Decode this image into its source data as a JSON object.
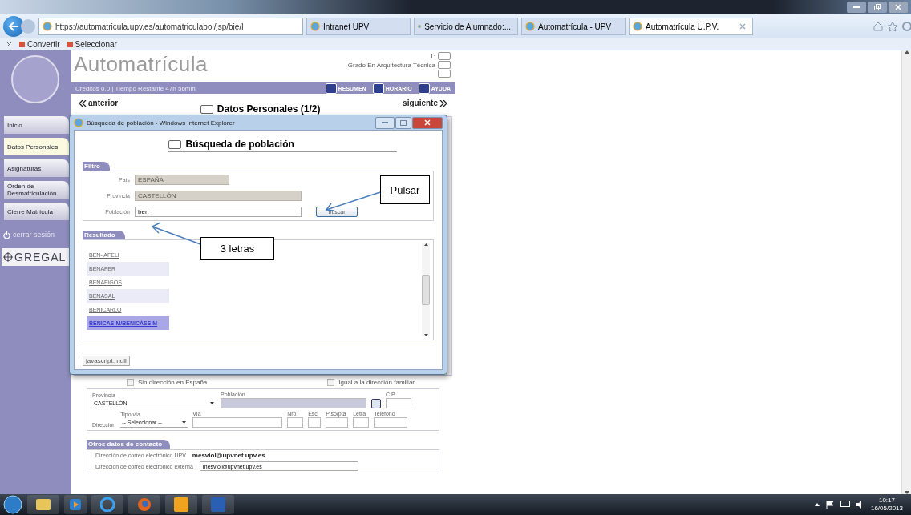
{
  "browser": {
    "address": "https://automatricula.upv.es/automatriculabol/jsp/bie/l",
    "tabs": [
      {
        "label": "Intranet UPV",
        "selected": false
      },
      {
        "label": "Servicio de Alumnado:...",
        "selected": false
      },
      {
        "label": "Automatrícula - UPV",
        "selected": false
      },
      {
        "label": "Automatrícula U.P.V.",
        "selected": true
      }
    ]
  },
  "command_bar": [
    "Convertir",
    "Seleccionar"
  ],
  "header": {
    "title": "Automatrícula",
    "info": "Créditos 0.0 | Tiempo Restante 47h 56min",
    "degrees": [
      {
        "label": "1:",
        "checked": false
      },
      {
        "label": "Grado En Arquitectura Técnica",
        "checked": false
      },
      {
        "checked": false
      }
    ],
    "buttons": [
      "RESUMEN",
      "HORARIO",
      "AYUDA"
    ]
  },
  "sidebar": {
    "items": [
      {
        "label": "Inicio",
        "selected": false
      },
      {
        "label": "Datos Personales",
        "selected": true
      },
      {
        "label": "Asignaturas",
        "selected": false
      },
      {
        "label": "Orden de Desmatriculación",
        "selected": false
      },
      {
        "label": "Cierre Matrícula",
        "selected": false
      }
    ],
    "logout": "cerrar sesión",
    "logo": "GREGAL"
  },
  "page": {
    "prev": "anterior",
    "title": "Datos Personales (1/2)",
    "next": "siguiente",
    "options": [
      {
        "label": "Sin dirección en España",
        "checked": false
      },
      {
        "label": "Igual a la dirección familiar",
        "checked": false
      }
    ],
    "provincia_label": "Provincia",
    "provincia_value": "CASTELLÓN",
    "poblacion_label": "Población",
    "cp_label": "C.P",
    "direccion_label": "Dirección",
    "tipo_via_label": "Tipo vía",
    "tipo_via_value": "-- Seleccionar --",
    "columns": [
      "Vía",
      "Nro",
      "Esc",
      "Piso/pta",
      "Letra",
      "Teléfono"
    ],
    "contact_tab": "Otros datos de contacto",
    "upv_email_label": "Dirección de correo electrónico UPV",
    "upv_email": "mesviol@upvnet.upv.es",
    "ext_email_label": "Dirección de correo electrónico externa",
    "ext_email": "mesviol@upvnet.upv.es"
  },
  "popup": {
    "title": "Búsqueda de población - Windows Internet Explorer",
    "heading": "Búsqueda de población",
    "filter_tab": "Filtro",
    "fields": [
      {
        "label": "País",
        "value": "ESPAÑA",
        "disabled": true
      },
      {
        "label": "Provincia",
        "value": "CASTELLÓN",
        "disabled": true
      },
      {
        "label": "Población",
        "value": "ben",
        "disabled": false
      }
    ],
    "search_button": "buscar",
    "results_tab": "Resultado",
    "results": [
      {
        "label": "BEN- AFELI",
        "selected": false
      },
      {
        "label": "BENAFER",
        "selected": false
      },
      {
        "label": "BENAFIGOS",
        "selected": false
      },
      {
        "label": "BENASAL",
        "selected": false
      },
      {
        "label": "BENICARLO",
        "selected": false
      },
      {
        "label": "BENICASIM/BENICÀSSIM",
        "selected": true
      }
    ],
    "status": "javascript: null"
  },
  "callouts": [
    {
      "text": "Pulsar"
    },
    {
      "text": "3 letras"
    }
  ],
  "taskbar": {
    "time": "10:17",
    "date": "16/05/2013"
  }
}
